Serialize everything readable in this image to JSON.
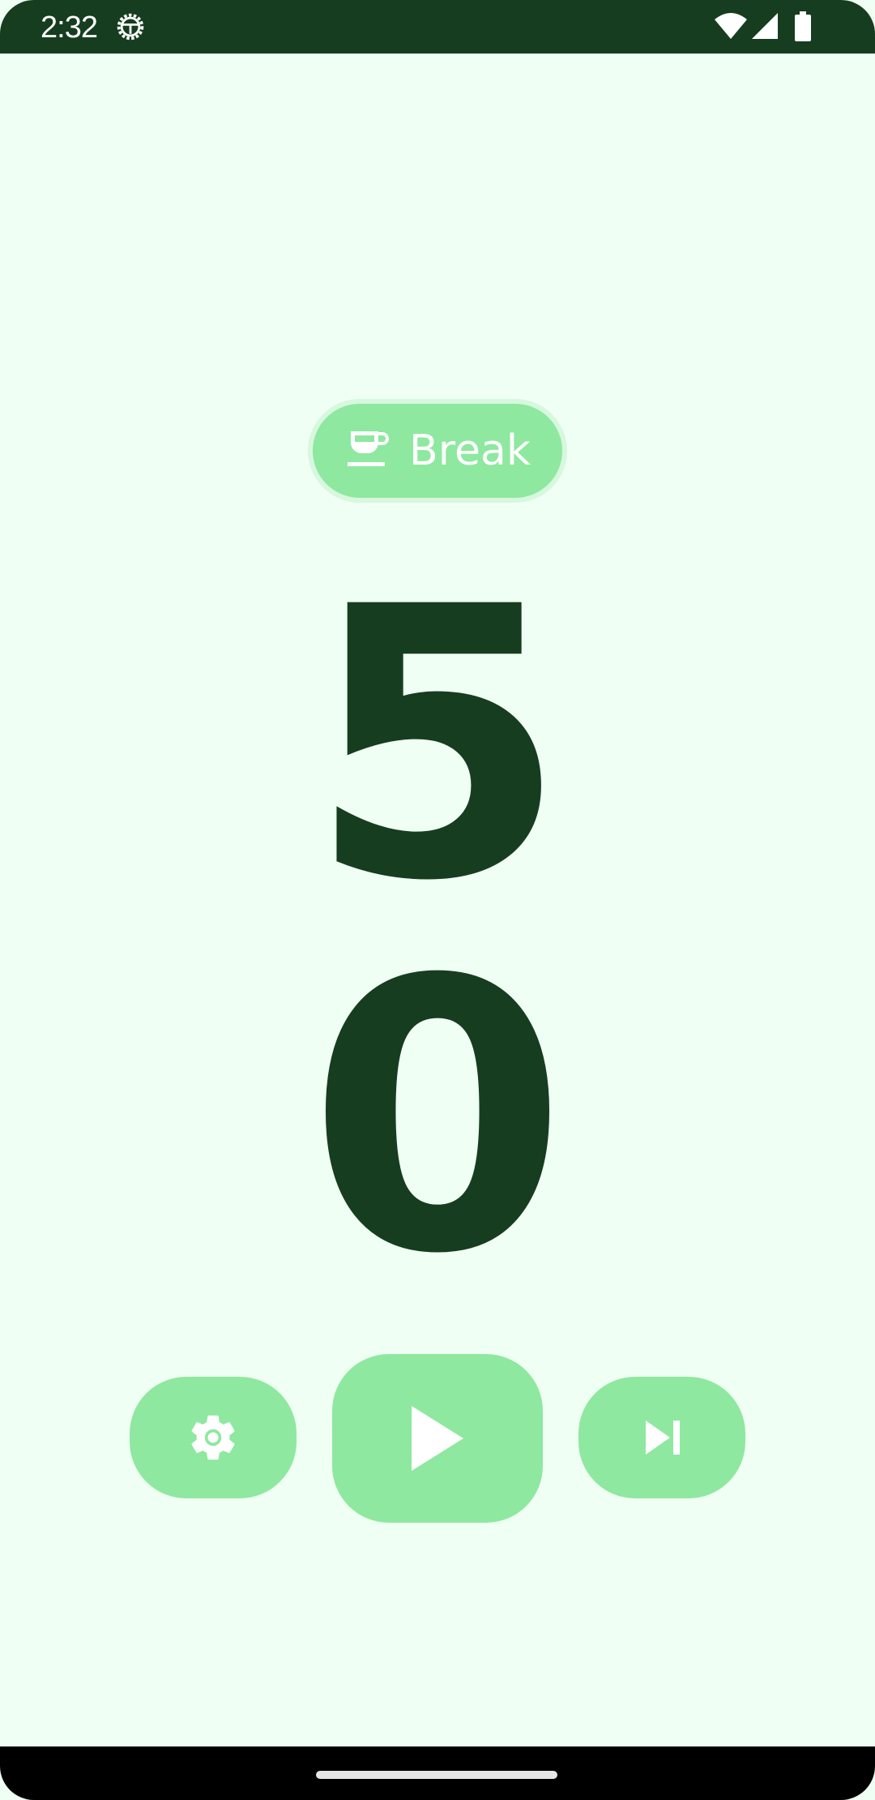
{
  "status_bar": {
    "time": "2:32",
    "icons": [
      "settings-icon",
      "wifi-icon",
      "signal-icon",
      "battery-icon"
    ]
  },
  "mode_chip": {
    "icon": "coffee-cup-icon",
    "label": "Break"
  },
  "timer": {
    "minutes": "5",
    "seconds": "0"
  },
  "controls": {
    "settings_icon": "settings-icon",
    "play_icon": "play-icon",
    "skip_icon": "skip-next-icon"
  },
  "colors": {
    "background": "#f0fff3",
    "dark_green": "#163d1f",
    "accent_green": "#8ee8a0",
    "chip_border": "#d7f7de"
  }
}
